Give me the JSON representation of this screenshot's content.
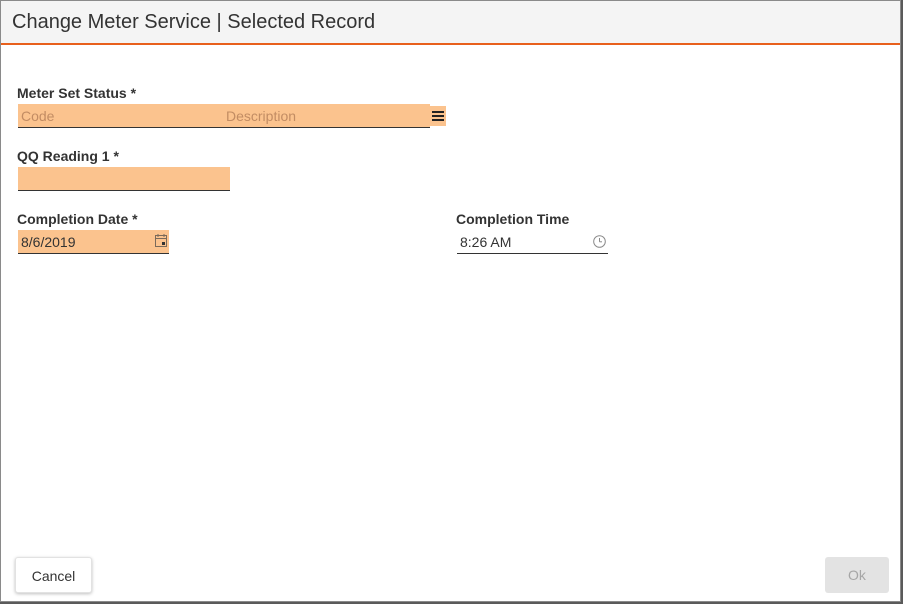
{
  "dialog": {
    "title": "Change Meter Service | Selected Record"
  },
  "meter_set_status": {
    "label": "Meter Set Status *",
    "code_placeholder": "Code",
    "description_placeholder": "Description"
  },
  "qq_reading": {
    "label": "QQ Reading 1 *",
    "value": ""
  },
  "completion_date": {
    "label": "Completion Date *",
    "value": "8/6/2019"
  },
  "completion_time": {
    "label": "Completion Time",
    "value": "8:26 AM"
  },
  "buttons": {
    "cancel": "Cancel",
    "ok": "Ok"
  },
  "colors": {
    "accent": "#e8601c",
    "required_field": "#fbc38e",
    "disabled_button": "#e3e3e3"
  },
  "icons": {
    "status_lookup": "list-icon",
    "date_picker": "calendar-icon",
    "time_picker": "clock-icon"
  }
}
